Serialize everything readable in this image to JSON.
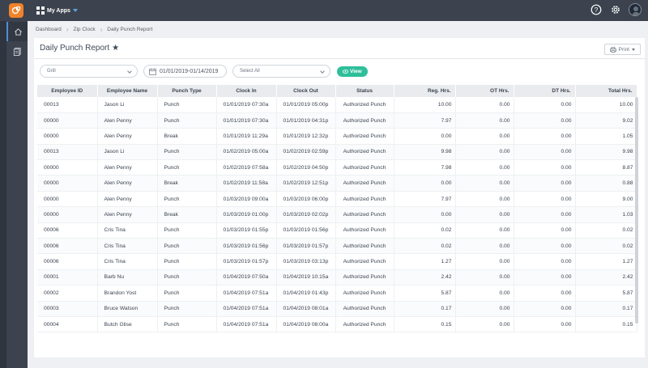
{
  "topbar": {
    "apps_label": "My Apps"
  },
  "breadcrumb": {
    "items": [
      "Dashboard",
      "Zip Clock",
      "Daily Punch Report"
    ]
  },
  "page": {
    "title": "Daily Punch Report",
    "print_label": "Print"
  },
  "filters": {
    "location": "Grill",
    "date_range": "01/01/2019-01/14/2019",
    "employee_select": "Select All",
    "view_label": "View"
  },
  "table": {
    "headers": [
      "Employee ID",
      "Employee Name",
      "Punch Type",
      "Clock In",
      "Clock Out",
      "Status",
      "Reg. Hrs.",
      "OT Hrs.",
      "DT Hrs.",
      "Total Hrs."
    ],
    "rows": [
      [
        "00013",
        "Jason Li",
        "Punch",
        "01/01/2019 07:30a",
        "01/01/2019 05:00p",
        "Authorized Punch",
        "10.00",
        "0.00",
        "0.00",
        "10.00"
      ],
      [
        "00000",
        "Alen Penny",
        "Punch",
        "01/01/2019 07:30a",
        "01/01/2019 04:31p",
        "Authorized Punch",
        "7.97",
        "0.00",
        "0.00",
        "9.02"
      ],
      [
        "00000",
        "Alen Penny",
        "Break",
        "01/01/2019 11:29a",
        "01/01/2019 12:32p",
        "Authorized Punch",
        "0.00",
        "0.00",
        "0.00",
        "1.05"
      ],
      [
        "00013",
        "Jason Li",
        "Punch",
        "01/02/2019 05:00a",
        "01/02/2019 02:59p",
        "Authorized Punch",
        "9.98",
        "0.00",
        "0.00",
        "9.98"
      ],
      [
        "00000",
        "Alen Penny",
        "Punch",
        "01/02/2019 07:58a",
        "01/02/2019 04:50p",
        "Authorized Punch",
        "7.98",
        "0.00",
        "0.00",
        "8.87"
      ],
      [
        "00000",
        "Alen Penny",
        "Break",
        "01/02/2019 11:58a",
        "01/02/2019 12:51p",
        "Authorized Punch",
        "0.00",
        "0.00",
        "0.00",
        "0.88"
      ],
      [
        "00000",
        "Alen Penny",
        "Punch",
        "01/03/2019 09:00a",
        "01/03/2019 06:00p",
        "Authorized Punch",
        "7.97",
        "0.00",
        "0.00",
        "9.00"
      ],
      [
        "00000",
        "Alen Penny",
        "Break",
        "01/03/2019 01:00p",
        "01/03/2019 02:02p",
        "Authorized Punch",
        "0.00",
        "0.00",
        "0.00",
        "1.03"
      ],
      [
        "00006",
        "Cris Tina",
        "Punch",
        "01/03/2019 01:55p",
        "01/03/2019 01:56p",
        "Authorized Punch",
        "0.02",
        "0.00",
        "0.00",
        "0.02"
      ],
      [
        "00006",
        "Cris Tina",
        "Punch",
        "01/03/2019 01:56p",
        "01/03/2019 01:57p",
        "Authorized Punch",
        "0.02",
        "0.00",
        "0.00",
        "0.02"
      ],
      [
        "00006",
        "Cris Tina",
        "Punch",
        "01/03/2019 01:57p",
        "01/03/2019 03:13p",
        "Authorized Punch",
        "1.27",
        "0.00",
        "0.00",
        "1.27"
      ],
      [
        "00001",
        "Barb Nu",
        "Punch",
        "01/04/2019 07:50a",
        "01/04/2019 10:15a",
        "Authorized Punch",
        "2.42",
        "0.00",
        "0.00",
        "2.42"
      ],
      [
        "00002",
        "Brandon Yost",
        "Punch",
        "01/04/2019 07:51a",
        "01/04/2019 01:43p",
        "Authorized Punch",
        "5.87",
        "0.00",
        "0.00",
        "5.87"
      ],
      [
        "00003",
        "Bruce Watson",
        "Punch",
        "01/04/2019 07:51a",
        "01/04/2019 08:01a",
        "Authorized Punch",
        "0.17",
        "0.00",
        "0.00",
        "0.17"
      ],
      [
        "00004",
        "Butch Glise",
        "Punch",
        "01/04/2019 07:51a",
        "01/04/2019 08:00a",
        "Authorized Punch",
        "0.15",
        "0.00",
        "0.00",
        "0.15"
      ]
    ]
  },
  "colors": {
    "topbar": "#3c434e",
    "accent_orange": "#f0822a",
    "view_button": "#2ebf9a"
  },
  "icons": [
    "app-logo-icon",
    "apps-grid-icon",
    "help-icon",
    "gear-icon",
    "home-icon",
    "report-icon",
    "star-icon",
    "printer-icon",
    "calendar-icon",
    "eye-icon"
  ]
}
